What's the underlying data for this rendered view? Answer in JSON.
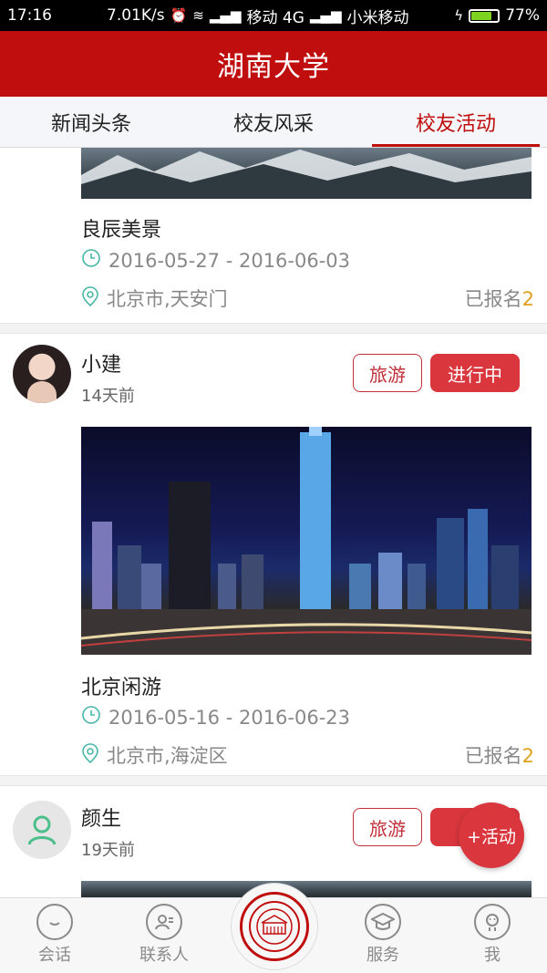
{
  "status": {
    "time": "17:16",
    "speed": "7.01K/s",
    "carrier1": "移动 4G",
    "carrier2": "小米移动",
    "battery": "77%",
    "battery_level": 0.77
  },
  "header": {
    "title": "湖南大学"
  },
  "tabs": [
    {
      "label": "新闻头条",
      "active": false
    },
    {
      "label": "校友风采",
      "active": false
    },
    {
      "label": "校友活动",
      "active": true
    }
  ],
  "feed": [
    {
      "title": "良辰美景",
      "dates": "2016-05-27 - 2016-06-03",
      "location": "北京市,天安门",
      "signup_label": "已报名",
      "signup_count": "2"
    },
    {
      "user": "小建",
      "time_ago": "14天前",
      "tag": "旅游",
      "status": "进行中",
      "title": "北京闲游",
      "dates": "2016-05-16 - 2016-06-23",
      "location": "北京市,海淀区",
      "signup_label": "已报名",
      "signup_count": "2"
    },
    {
      "user": "颜生",
      "time_ago": "19天前",
      "tag": "旅游",
      "status": "E"
    }
  ],
  "fab": {
    "label": "+活动"
  },
  "bottom_nav": [
    {
      "label": "会话",
      "icon": "chat-icon"
    },
    {
      "label": "联系人",
      "icon": "contacts-icon"
    },
    {
      "label": "服务",
      "icon": "graduation-cap-icon"
    },
    {
      "label": "我",
      "icon": "profile-icon"
    }
  ],
  "colors": {
    "brand": "#c00d0d",
    "accent": "#d9363e",
    "count": "#e0a020"
  }
}
